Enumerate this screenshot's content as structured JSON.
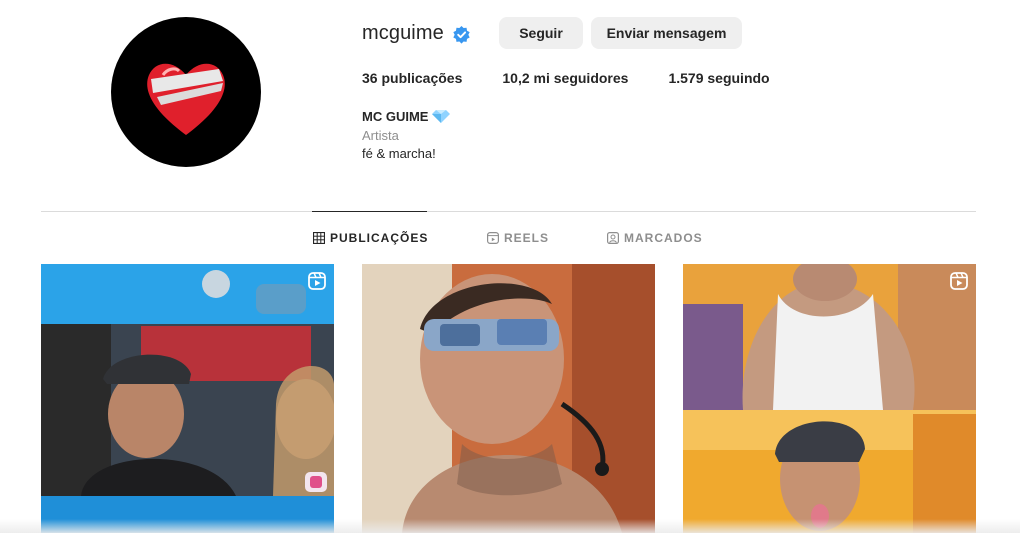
{
  "profile": {
    "username": "mcguime",
    "follow_label": "Seguir",
    "message_label": "Enviar mensagem",
    "stats": {
      "posts": "36 publicações",
      "followers": "10,2 mi seguidores",
      "following": "1.579 seguindo"
    },
    "full_name": "MC GUIME",
    "category": "Artista",
    "bio": "fé & marcha!"
  },
  "tabs": [
    {
      "label": "PUBLICAÇÕES",
      "icon": "grid-icon",
      "active": true
    },
    {
      "label": "REELS",
      "icon": "reels-icon",
      "active": false
    },
    {
      "label": "MARCADOS",
      "icon": "tagged-icon",
      "active": false
    }
  ],
  "posts": [
    {
      "type": "reel",
      "icon": "reels-icon"
    },
    {
      "type": "photo"
    },
    {
      "type": "reel",
      "icon": "reels-icon"
    }
  ],
  "colors": {
    "verified": "#3897f0",
    "button_bg": "#efefef",
    "text": "#262626",
    "muted": "#8e8e8e"
  }
}
